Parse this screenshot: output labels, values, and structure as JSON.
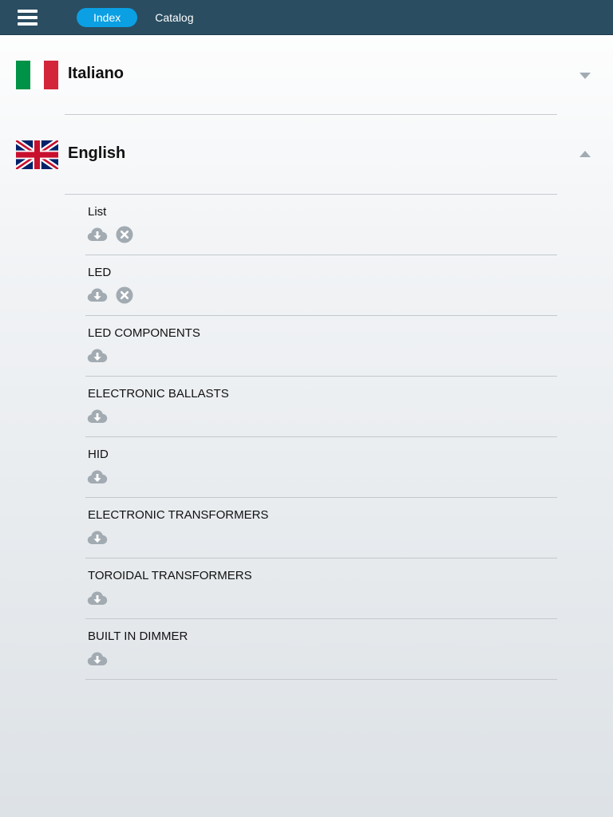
{
  "header": {
    "tabs": [
      {
        "label": "Index",
        "active": true
      },
      {
        "label": "Catalog",
        "active": false
      }
    ]
  },
  "languages": [
    {
      "name": "Italiano",
      "flag": "italy-flag-icon",
      "expanded": false,
      "items": []
    },
    {
      "name": "English",
      "flag": "uk-flag-icon",
      "expanded": true,
      "items": [
        {
          "name": "List",
          "downloadable": true,
          "removable": true
        },
        {
          "name": "LED",
          "downloadable": true,
          "removable": true
        },
        {
          "name": "LED COMPONENTS",
          "downloadable": true,
          "removable": false
        },
        {
          "name": "ELECTRONIC BALLASTS",
          "downloadable": true,
          "removable": false
        },
        {
          "name": "HID",
          "downloadable": true,
          "removable": false
        },
        {
          "name": "ELECTRONIC TRANSFORMERS",
          "downloadable": true,
          "removable": false
        },
        {
          "name": "TOROIDAL TRANSFORMERS",
          "downloadable": true,
          "removable": false
        },
        {
          "name": "BUILT IN DIMMER",
          "downloadable": true,
          "removable": false
        }
      ]
    }
  ],
  "colors": {
    "header_bg": "#2a4d61",
    "tab_active": "#0b9fe3",
    "icon_gray": "#a2abb2"
  }
}
